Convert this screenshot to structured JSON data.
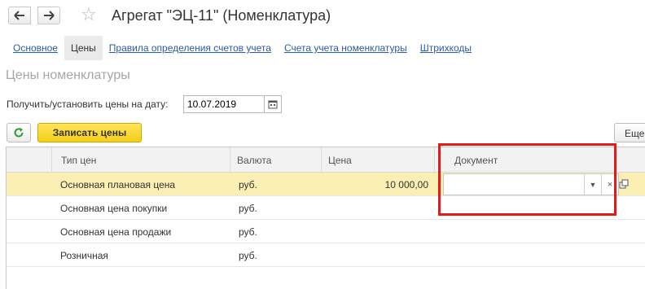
{
  "header": {
    "back_icon": "arrow-left-icon",
    "forward_icon": "arrow-right-icon",
    "favorite_icon": "star-icon",
    "title": "Агрегат \"ЭЦ-11\" (Номенклатура)"
  },
  "tabs": [
    {
      "label": "Основное",
      "active": false
    },
    {
      "label": "Цены",
      "active": true
    },
    {
      "label": "Правила определения счетов учета",
      "active": false
    },
    {
      "label": "Счета учета номенклатуры",
      "active": false
    },
    {
      "label": "Штрихкоды",
      "active": false
    }
  ],
  "section_title": "Цены номенклатуры",
  "date": {
    "label": "Получить/установить цены на дату:",
    "value": "10.07.2019",
    "calendar_icon": "calendar-icon"
  },
  "toolbar": {
    "refresh_icon": "refresh-icon",
    "save_label": "Записать цены",
    "more_label": "Еще"
  },
  "table": {
    "columns": [
      "Тип цен",
      "Валюта",
      "Цена",
      "Документ"
    ],
    "rows": [
      {
        "type": "Основная плановая цена",
        "currency": "руб.",
        "price": "10 000,00",
        "document": "",
        "selected": true
      },
      {
        "type": "Основная цена покупки",
        "currency": "руб.",
        "price": "",
        "document": ""
      },
      {
        "type": "Основная цена продажи",
        "currency": "руб.",
        "price": "",
        "document": ""
      },
      {
        "type": "Розничная",
        "currency": "руб.",
        "price": "",
        "document": ""
      }
    ],
    "document_editor": {
      "dropdown_icon": "triangle-down-icon",
      "clear_label": "×",
      "open_icon": "open-window-icon"
    }
  },
  "colors": {
    "accent_yellow": "#f6cf14",
    "selected_row": "#fbefb4",
    "link": "#2a5ca8",
    "highlight_frame": "#e01b1b"
  }
}
